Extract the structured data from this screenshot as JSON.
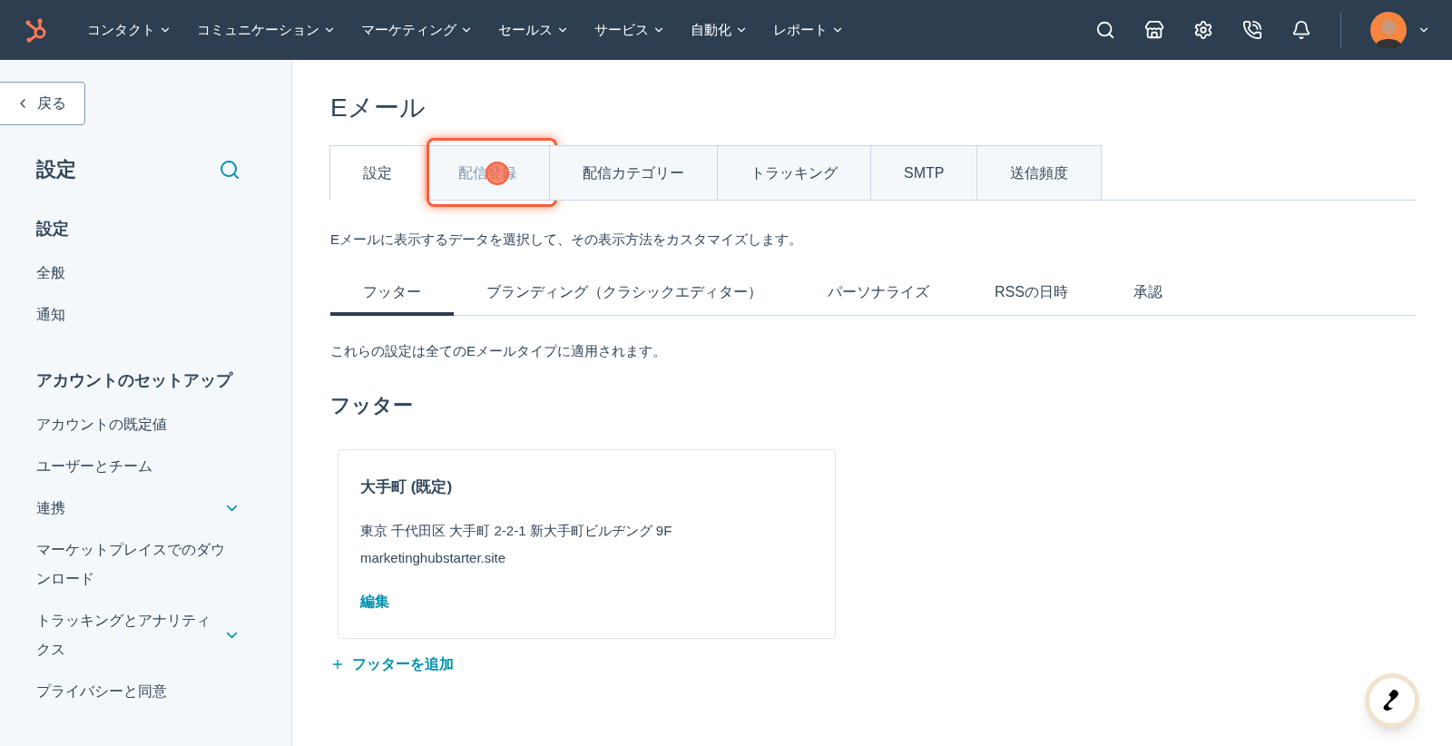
{
  "top_nav": {
    "menus": [
      {
        "label": "コンタクト"
      },
      {
        "label": "コミュニケーション"
      },
      {
        "label": "マーケティング"
      },
      {
        "label": "セールス"
      },
      {
        "label": "サービス"
      },
      {
        "label": "自動化"
      },
      {
        "label": "レポート"
      }
    ]
  },
  "sidebar": {
    "back_button": "戻る",
    "title": "設定",
    "sections": [
      {
        "heading": "設定",
        "items": [
          {
            "label": "全般",
            "expandable": false
          },
          {
            "label": "通知",
            "expandable": false
          }
        ]
      },
      {
        "heading": "アカウントのセットアップ",
        "items": [
          {
            "label": "アカウントの既定値",
            "expandable": false
          },
          {
            "label": "ユーザーとチーム",
            "expandable": false
          },
          {
            "label": "連携",
            "expandable": true
          },
          {
            "label": "マーケットプレイスでのダウンロード",
            "expandable": false
          },
          {
            "label": "トラッキングとアナリティクス",
            "expandable": true
          },
          {
            "label": "プライバシーと同意",
            "expandable": false
          }
        ]
      }
    ]
  },
  "page": {
    "title": "Eメール",
    "tabs": [
      {
        "label": "設定",
        "selected": true,
        "highlighted": false
      },
      {
        "label": "配信登録",
        "selected": false,
        "highlighted": true
      },
      {
        "label": "配信カテゴリー",
        "selected": false,
        "highlighted": false
      },
      {
        "label": "トラッキング",
        "selected": false,
        "highlighted": false
      },
      {
        "label": "SMTP",
        "selected": false,
        "highlighted": false
      },
      {
        "label": "送信頻度",
        "selected": false,
        "highlighted": false
      }
    ],
    "description": "Eメールに表示するデータを選択して、その表示方法をカスタマイズします。",
    "subtabs": [
      {
        "label": "フッター",
        "selected": true
      },
      {
        "label": "ブランディング（クラシックエディター）",
        "selected": false
      },
      {
        "label": "パーソナライズ",
        "selected": false
      },
      {
        "label": "RSSの日時",
        "selected": false
      },
      {
        "label": "承認",
        "selected": false
      }
    ],
    "note": "これらの設定は全てのEメールタイプに適用されます。",
    "section_title": "フッター",
    "footer_card": {
      "name": "大手町 (既定)",
      "address": "東京 千代田区 大手町 2-2-1 新大手町ビルヂング 9F",
      "domain": "marketinghubstarter.site",
      "edit_link": "編集"
    },
    "add_footer": "フッターを追加"
  }
}
